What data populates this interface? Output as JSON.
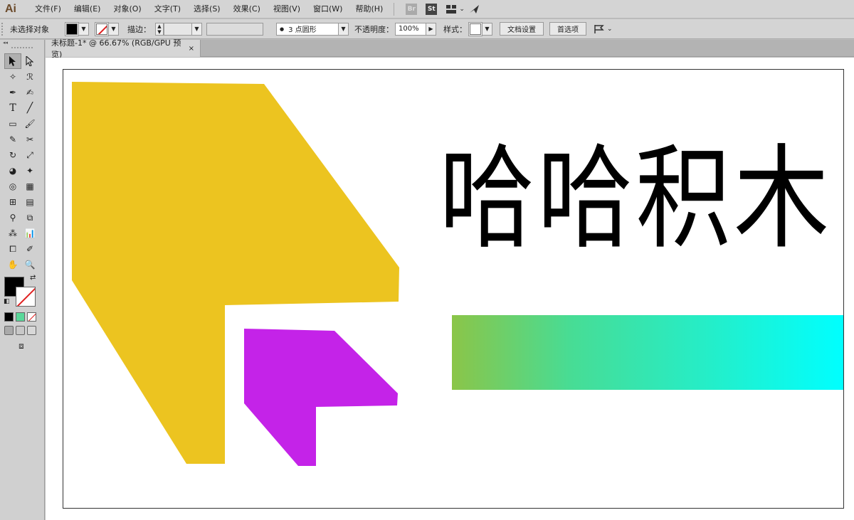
{
  "app": {
    "logo": "Ai"
  },
  "menu": [
    "文件(F)",
    "编辑(E)",
    "对象(O)",
    "文字(T)",
    "选择(S)",
    "效果(C)",
    "视图(V)",
    "窗口(W)",
    "帮助(H)"
  ],
  "menubar_icons": {
    "bridge": "Br",
    "stock": "St"
  },
  "control": {
    "selection_status": "未选择对象",
    "stroke_label": "描边：",
    "brush_value": "3 点圆形",
    "opacity_label": "不透明度：",
    "opacity_value": "100%",
    "style_label": "样式：",
    "doc_setup_button": "文档设置",
    "preferences_button": "首选项"
  },
  "document": {
    "tab_title": "未标题-1* @ 66.67% (RGB/GPU 预览)",
    "close_glyph": "×"
  },
  "artwork": {
    "heading_text": "哈哈积木",
    "colors": {
      "yellow_shape": "#ecc420",
      "purple_shape": "#c423e8",
      "gradient_start": "#8bc548",
      "gradient_end": "#00ffff",
      "text": "#000000"
    }
  },
  "tools": [
    "selection-tool",
    "direct-selection-tool",
    "magic-wand-tool",
    "lasso-tool",
    "pen-tool",
    "curvature-tool",
    "type-tool",
    "line-tool",
    "rectangle-tool",
    "paintbrush-tool",
    "shaper-tool",
    "scissors-tool",
    "rotate-tool",
    "scale-tool",
    "warp-tool",
    "free-transform-tool",
    "shape-builder-tool",
    "perspective-grid-tool",
    "mesh-tool",
    "gradient-tool",
    "eyedropper-tool",
    "blend-tool",
    "symbol-sprayer-tool",
    "column-graph-tool",
    "artboard-tool",
    "slice-tool",
    "hand-tool",
    "zoom-tool"
  ]
}
